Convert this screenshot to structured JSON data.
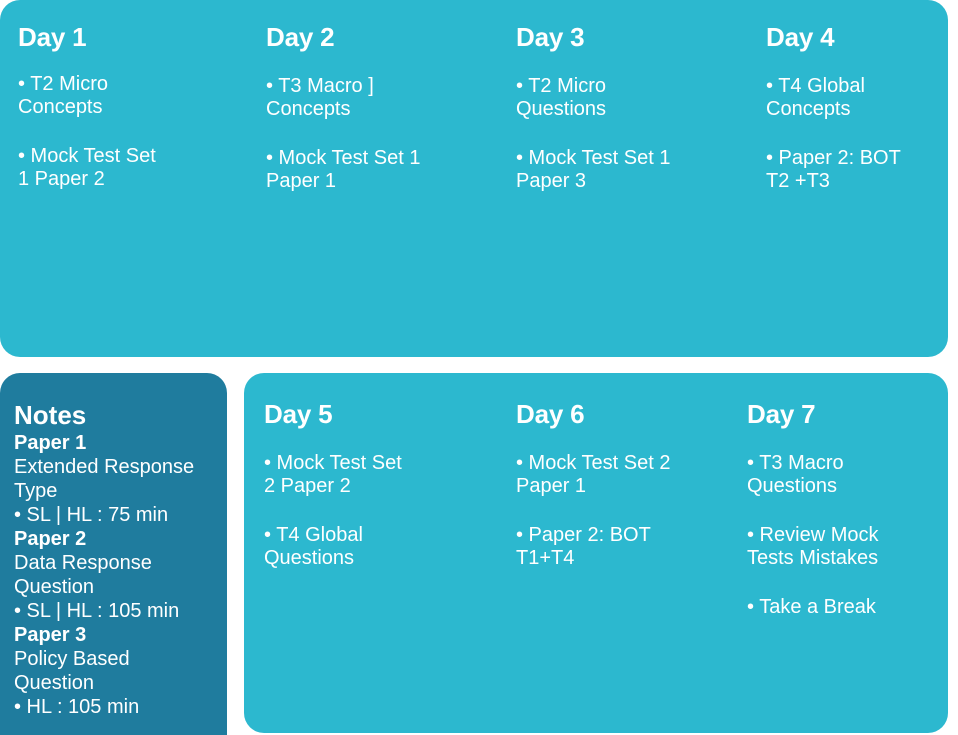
{
  "theme": {
    "panel_color": "#2cb8cf",
    "notes_panel_color": "#1f7c9e",
    "text_color": "#ffffff",
    "page_background": "#ffffff"
  },
  "top_row": {
    "days": [
      {
        "title": "Day 1",
        "tasks": [
          "• T2  Micro\nConcepts",
          "• Mock Test Set\n 1 Paper 2"
        ]
      },
      {
        "title": "Day 2",
        "tasks": [
          "• T3 Macro ]\nConcepts",
          "• Mock Test Set 1\nPaper 1"
        ]
      },
      {
        "title": "Day 3",
        "tasks": [
          "• T2 Micro\nQuestions",
          "• Mock Test Set 1\nPaper 3"
        ]
      },
      {
        "title": "Day 4",
        "tasks": [
          "• T4 Global\nConcepts",
          "• Paper 2: BOT\nT2 +T3"
        ]
      }
    ]
  },
  "notes": {
    "title": "Notes",
    "entries": [
      {
        "type": "heading",
        "text": "Paper 1"
      },
      {
        "type": "text",
        "text": "Extended Response\nType"
      },
      {
        "type": "bullet",
        "text": "• SL | HL : 75 min"
      },
      {
        "type": "heading",
        "text": "Paper 2"
      },
      {
        "type": "text",
        "text": "Data Response\nQuestion"
      },
      {
        "type": "bullet",
        "text": "• SL | HL : 105 min"
      },
      {
        "type": "heading",
        "text": "Paper 3"
      },
      {
        "type": "text",
        "text": "Policy Based\nQuestion"
      },
      {
        "type": "bullet",
        "text": "• HL : 105 min"
      }
    ]
  },
  "bottom_row": {
    "days": [
      {
        "title": "Day 5",
        "tasks": [
          "• Mock Test Set\n2 Paper 2",
          "• T4 Global\nQuestions"
        ]
      },
      {
        "title": "Day 6",
        "tasks": [
          "• Mock Test Set 2\nPaper 1",
          "• Paper 2: BOT\nT1+T4"
        ]
      },
      {
        "title": "Day 7",
        "tasks": [
          "• T3 Macro\nQuestions",
          "• Review Mock\nTests Mistakes",
          "• Take a Break"
        ]
      }
    ]
  }
}
